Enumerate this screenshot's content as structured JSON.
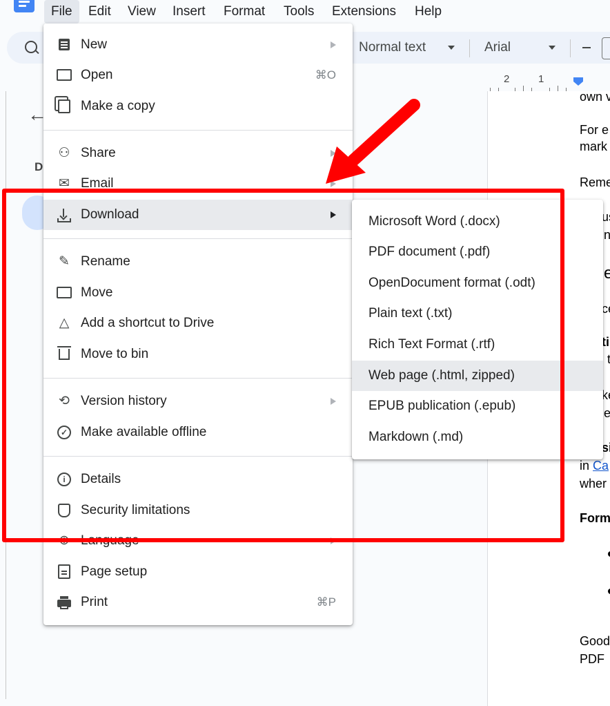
{
  "menubar": {
    "items": [
      "File",
      "Edit",
      "View",
      "Insert",
      "Format",
      "Tools",
      "Extensions",
      "Help"
    ]
  },
  "toolbar": {
    "style": "Normal text",
    "font": "Arial",
    "minus": "–"
  },
  "ruler": {
    "numbers": [
      "2",
      "1"
    ]
  },
  "sidebar": {
    "letter": "D"
  },
  "document": {
    "lines": [
      "own v",
      "For e",
      "mark",
      "Reme",
      "us",
      "n",
      "ep",
      "ce",
      "ti",
      "t",
      "ke",
      "e",
      "si",
      "in",
      "Ca",
      "wher",
      "Form",
      "Good",
      "PDF"
    ]
  },
  "file_menu": {
    "items": [
      {
        "label": "New",
        "submenu": true
      },
      {
        "label": "Open",
        "shortcut": "⌘O"
      },
      {
        "label": "Make a copy"
      },
      {
        "label": "Share",
        "submenu": true
      },
      {
        "label": "Email",
        "submenu": true
      },
      {
        "label": "Download",
        "submenu": true,
        "highlighted": true
      },
      {
        "label": "Rename"
      },
      {
        "label": "Move"
      },
      {
        "label": "Add a shortcut to Drive"
      },
      {
        "label": "Move to bin"
      },
      {
        "label": "Version history",
        "submenu": true
      },
      {
        "label": "Make available offline"
      },
      {
        "label": "Details"
      },
      {
        "label": "Security limitations"
      },
      {
        "label": "Language",
        "submenu": true
      },
      {
        "label": "Page setup"
      },
      {
        "label": "Print",
        "shortcut": "⌘P"
      }
    ]
  },
  "download_submenu": {
    "items": [
      {
        "label": "Microsoft Word (.docx)"
      },
      {
        "label": "PDF document (.pdf)"
      },
      {
        "label": "OpenDocument format (.odt)"
      },
      {
        "label": "Plain text (.txt)"
      },
      {
        "label": "Rich Text Format (.rtf)"
      },
      {
        "label": "Web page (.html, zipped)",
        "highlighted": true
      },
      {
        "label": "EPUB publication (.epub)"
      },
      {
        "label": "Markdown (.md)"
      }
    ]
  },
  "annotation": {
    "color": "#ff0000"
  }
}
